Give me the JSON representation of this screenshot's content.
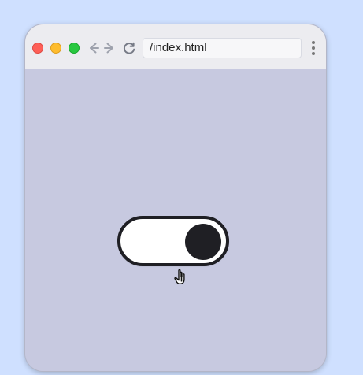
{
  "browser": {
    "address_text": "/index.html",
    "icons": [
      "close-window-icon",
      "minimize-window-icon",
      "maximize-window-icon",
      "back-arrow-icon",
      "forward-arrow-icon",
      "reload-icon",
      "menu-dots-icon",
      "pointer-hand-icon"
    ]
  },
  "toggle": {
    "state": "on",
    "colors": {
      "track": "#ffffff",
      "border": "#1f1f24",
      "knob": "#1f1f24",
      "background": "#c7c9e0"
    }
  }
}
